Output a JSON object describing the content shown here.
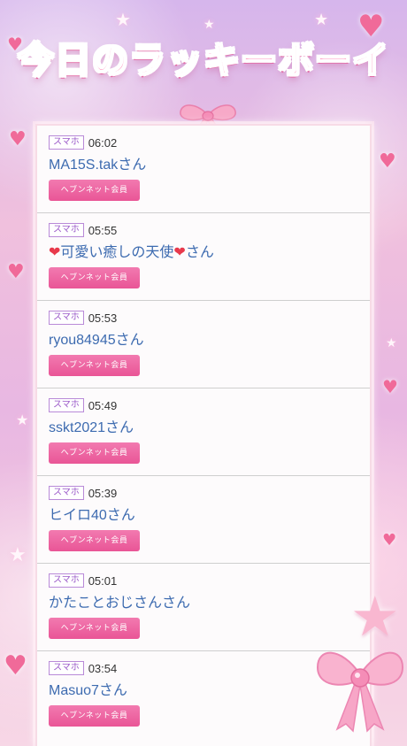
{
  "title": "今日のラッキーボーイ",
  "member_label": "ヘブンネット会員",
  "device_badge": "スマホ",
  "entries": [
    {
      "device": "スマホ",
      "time": "06:02",
      "name": "MA15S.takさん"
    },
    {
      "device": "スマホ",
      "time": "05:55",
      "name_prefix": "❤",
      "name_main": "可愛い癒しの天使",
      "name_suffix": "❤",
      "name_end": "さん"
    },
    {
      "device": "スマホ",
      "time": "05:53",
      "name": "ryou84945さん"
    },
    {
      "device": "スマホ",
      "time": "05:49",
      "name": "sskt2021さん"
    },
    {
      "device": "スマホ",
      "time": "05:39",
      "name": "ヒイロ40さん"
    },
    {
      "device": "スマホ",
      "time": "05:01",
      "name": "かたことおじさんさん"
    },
    {
      "device": "スマホ",
      "time": "03:54",
      "name": "Masuo7さん"
    }
  ],
  "colors": {
    "title": "#ff5f9e",
    "name": "#3d6bb0",
    "member_button": "#e95596",
    "badge": "#9a58c8"
  }
}
